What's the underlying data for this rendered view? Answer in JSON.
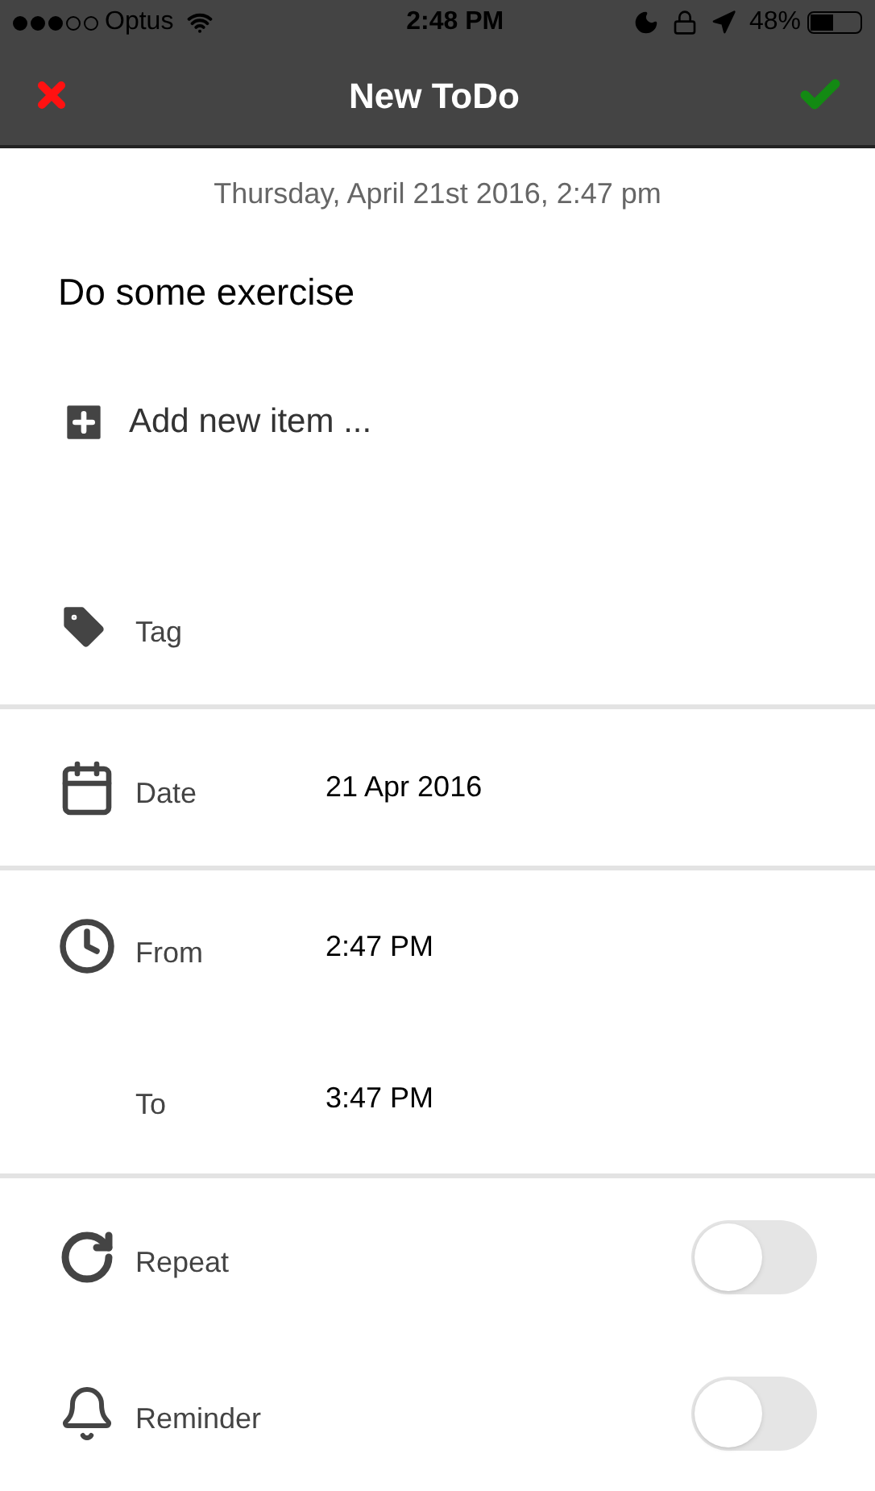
{
  "status_bar": {
    "carrier": "Optus",
    "time": "2:48 PM",
    "battery": "48%"
  },
  "nav": {
    "title": "New ToDo"
  },
  "created": "Thursday, April 21st 2016, 2:47 pm",
  "todo_title": "Do some exercise",
  "add_item": {
    "placeholder": "Add new item ..."
  },
  "sections": [
    {
      "rows": [
        {
          "kind": "tag",
          "label": "Tag"
        }
      ]
    },
    {
      "rows": [
        {
          "kind": "date",
          "label": "Date",
          "value": "21 Apr 2016"
        }
      ]
    },
    {
      "rows": [
        {
          "kind": "from",
          "label": "From",
          "value": "2:47 PM"
        },
        {
          "kind": "to",
          "label": "To",
          "value": "3:47 PM"
        }
      ]
    },
    {
      "rows": [
        {
          "kind": "repeat",
          "label": "Repeat",
          "on": false
        },
        {
          "kind": "reminder",
          "label": "Reminder",
          "on": false
        }
      ]
    }
  ]
}
